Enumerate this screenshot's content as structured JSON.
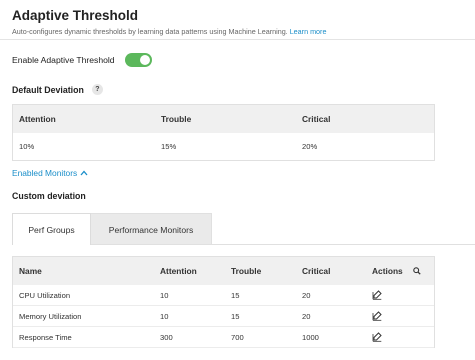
{
  "header": {
    "title": "Adaptive Threshold",
    "subtitle": "Auto-configures dynamic thresholds by learning data patterns using Machine Learning.",
    "learn_more": "Learn more"
  },
  "enable": {
    "label": "Enable Adaptive Threshold",
    "state": "on",
    "color": "#5cb85c"
  },
  "default_deviation": {
    "title": "Default Deviation",
    "help": "?",
    "columns": [
      "Attention",
      "Trouble",
      "Critical"
    ],
    "values": [
      "10%",
      "15%",
      "20%"
    ]
  },
  "enabled_monitors_link": "Enabled Monitors",
  "custom_deviation": {
    "title": "Custom deviation",
    "tabs": [
      {
        "label": "Perf Groups",
        "active": true
      },
      {
        "label": "Performance Monitors",
        "active": false
      }
    ],
    "columns": [
      "Name",
      "Attention",
      "Trouble",
      "Critical",
      "Actions"
    ],
    "rows": [
      {
        "name": "CPU Utilization",
        "attention": "10",
        "trouble": "15",
        "critical": "20"
      },
      {
        "name": "Memory Utilization",
        "attention": "10",
        "trouble": "15",
        "critical": "20"
      },
      {
        "name": "Response Time",
        "attention": "300",
        "trouble": "700",
        "critical": "1000"
      }
    ]
  },
  "colors": {
    "accent": "#1a8ec9",
    "header_bg": "#f0f0f0"
  }
}
